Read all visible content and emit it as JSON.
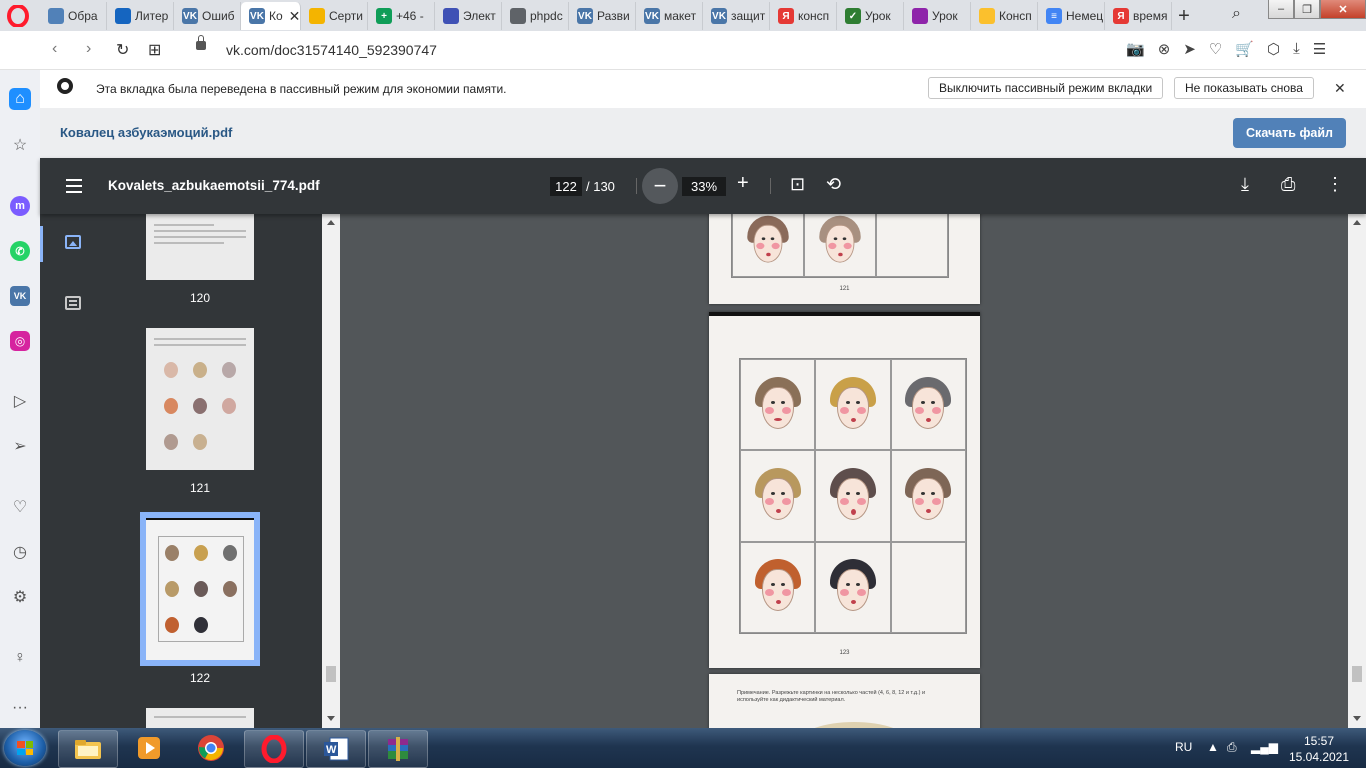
{
  "browser": {
    "tabs": [
      {
        "label": "Обра",
        "icon": "vk-icon",
        "color": "#5181b8",
        "glyph": ""
      },
      {
        "label": "Литер",
        "icon": "bookmark-shield-icon",
        "color": "#1565c0",
        "glyph": ""
      },
      {
        "label": "Ошиб",
        "icon": "vk-icon",
        "color": "#4a76a8",
        "glyph": "VK"
      },
      {
        "label": "Ко",
        "icon": "vk-icon",
        "color": "#4a76a8",
        "glyph": "VK",
        "active": true
      },
      {
        "label": "Серти",
        "icon": "slides-icon",
        "color": "#f4b400",
        "glyph": ""
      },
      {
        "label": "+46 -",
        "icon": "sheets-icon",
        "color": "#0f9d58",
        "glyph": "+"
      },
      {
        "label": "Элект",
        "icon": "form-icon",
        "color": "#3f51b5",
        "glyph": ""
      },
      {
        "label": "phpdc",
        "icon": "file-icon",
        "color": "#5f6368",
        "glyph": ""
      },
      {
        "label": "Разви",
        "icon": "vk-icon",
        "color": "#4a76a8",
        "glyph": "VK"
      },
      {
        "label": "макет",
        "icon": "vk-icon",
        "color": "#4a76a8",
        "glyph": "VK"
      },
      {
        "label": "защит",
        "icon": "vk-icon",
        "color": "#4a76a8",
        "glyph": "VK"
      },
      {
        "label": "консп",
        "icon": "yandex-icon",
        "color": "#e53935",
        "glyph": "Я"
      },
      {
        "label": "Урок",
        "icon": "check-icon",
        "color": "#2e7d32",
        "glyph": "✓"
      },
      {
        "label": "Урок",
        "icon": "paint-icon",
        "color": "#8e24aa",
        "glyph": ""
      },
      {
        "label": "Консп",
        "icon": "pencil-icon",
        "color": "#fbc02d",
        "glyph": ""
      },
      {
        "label": "Немец",
        "icon": "docs-icon",
        "color": "#4285f4",
        "glyph": "≡"
      },
      {
        "label": "время",
        "icon": "yandex-icon",
        "color": "#e53935",
        "glyph": "Я"
      }
    ],
    "url": "vk.com/doc31574140_592390747"
  },
  "infobar": {
    "message": "Эта вкладка была переведена в пассивный режим для экономии памяти.",
    "disable_button": "Выключить пассивный режим вкладки",
    "dont_show_button": "Не показывать снова"
  },
  "doc": {
    "title": "Ковалец азбукаэмоций.pdf",
    "download_button": "Скачать файл"
  },
  "pdf": {
    "filename": "Kovalets_azbukaemotsii_774.pdf",
    "current_page": "122",
    "total_pages": "/ 130",
    "zoom": "33%",
    "thumbnails": [
      {
        "label": "120"
      },
      {
        "label": "121"
      },
      {
        "label": "122",
        "selected": true
      }
    ],
    "visible_pages": {
      "prev_page_number": "121",
      "current_page_number": "123",
      "next_page_note": "Примечание. Разрежьте картинки на несколько частей (4, 6, 8, 12 и т.д.) и используйте как дидактический материал."
    }
  },
  "taskbar": {
    "language": "RU",
    "time": "15:57",
    "date": "15.04.2021"
  },
  "colors": {
    "vk_blue": "#5181b8",
    "pdf_toolbar": "#323639",
    "pdf_background": "#525659",
    "accent": "#8ab4f8"
  }
}
